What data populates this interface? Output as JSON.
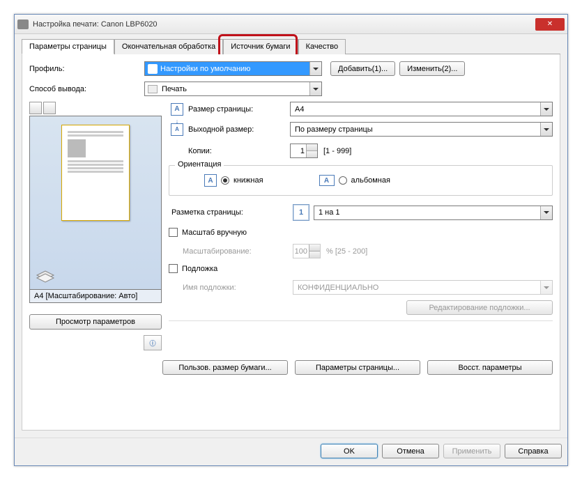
{
  "window": {
    "title": "Настройка печати: Canon LBP6020"
  },
  "tabs": {
    "page_params": "Параметры страницы",
    "finishing": "Окончательная обработка",
    "paper_source": "Источник бумаги",
    "quality": "Качество"
  },
  "profile": {
    "label": "Профиль:",
    "value": "Настройки по умолчанию",
    "add_btn": "Добавить(1)...",
    "edit_btn": "Изменить(2)..."
  },
  "output": {
    "label": "Способ вывода:",
    "value": "Печать"
  },
  "preview": {
    "status": "A4 [Масштабирование: Авто]",
    "view_params_btn": "Просмотр параметров"
  },
  "page_size": {
    "label": "Размер страницы:",
    "value": "A4"
  },
  "output_size": {
    "label": "Выходной размер:",
    "value": "По размеру страницы"
  },
  "copies": {
    "label": "Копии:",
    "value": "1",
    "range": "[1 - 999]"
  },
  "orientation": {
    "legend": "Ориентация",
    "portrait": "книжная",
    "landscape": "альбомная"
  },
  "layout": {
    "label": "Разметка страницы:",
    "value": "1 на 1",
    "icon": "1"
  },
  "manual_scale": {
    "checkbox": "Масштаб вручную",
    "scaling_label": "Масштабирование:",
    "value": "100",
    "range": "% [25 - 200]"
  },
  "watermark": {
    "checkbox": "Подложка",
    "name_label": "Имя подложки:",
    "value": "КОНФИДЕНЦИАЛЬНО",
    "edit_btn": "Редактирование подложки..."
  },
  "bottom": {
    "custom_size": "Пользов. размер бумаги...",
    "page_options": "Параметры страницы...",
    "restore": "Восст. параметры"
  },
  "dialog": {
    "ok": "OK",
    "cancel": "Отмена",
    "apply": "Применить",
    "help": "Справка"
  }
}
